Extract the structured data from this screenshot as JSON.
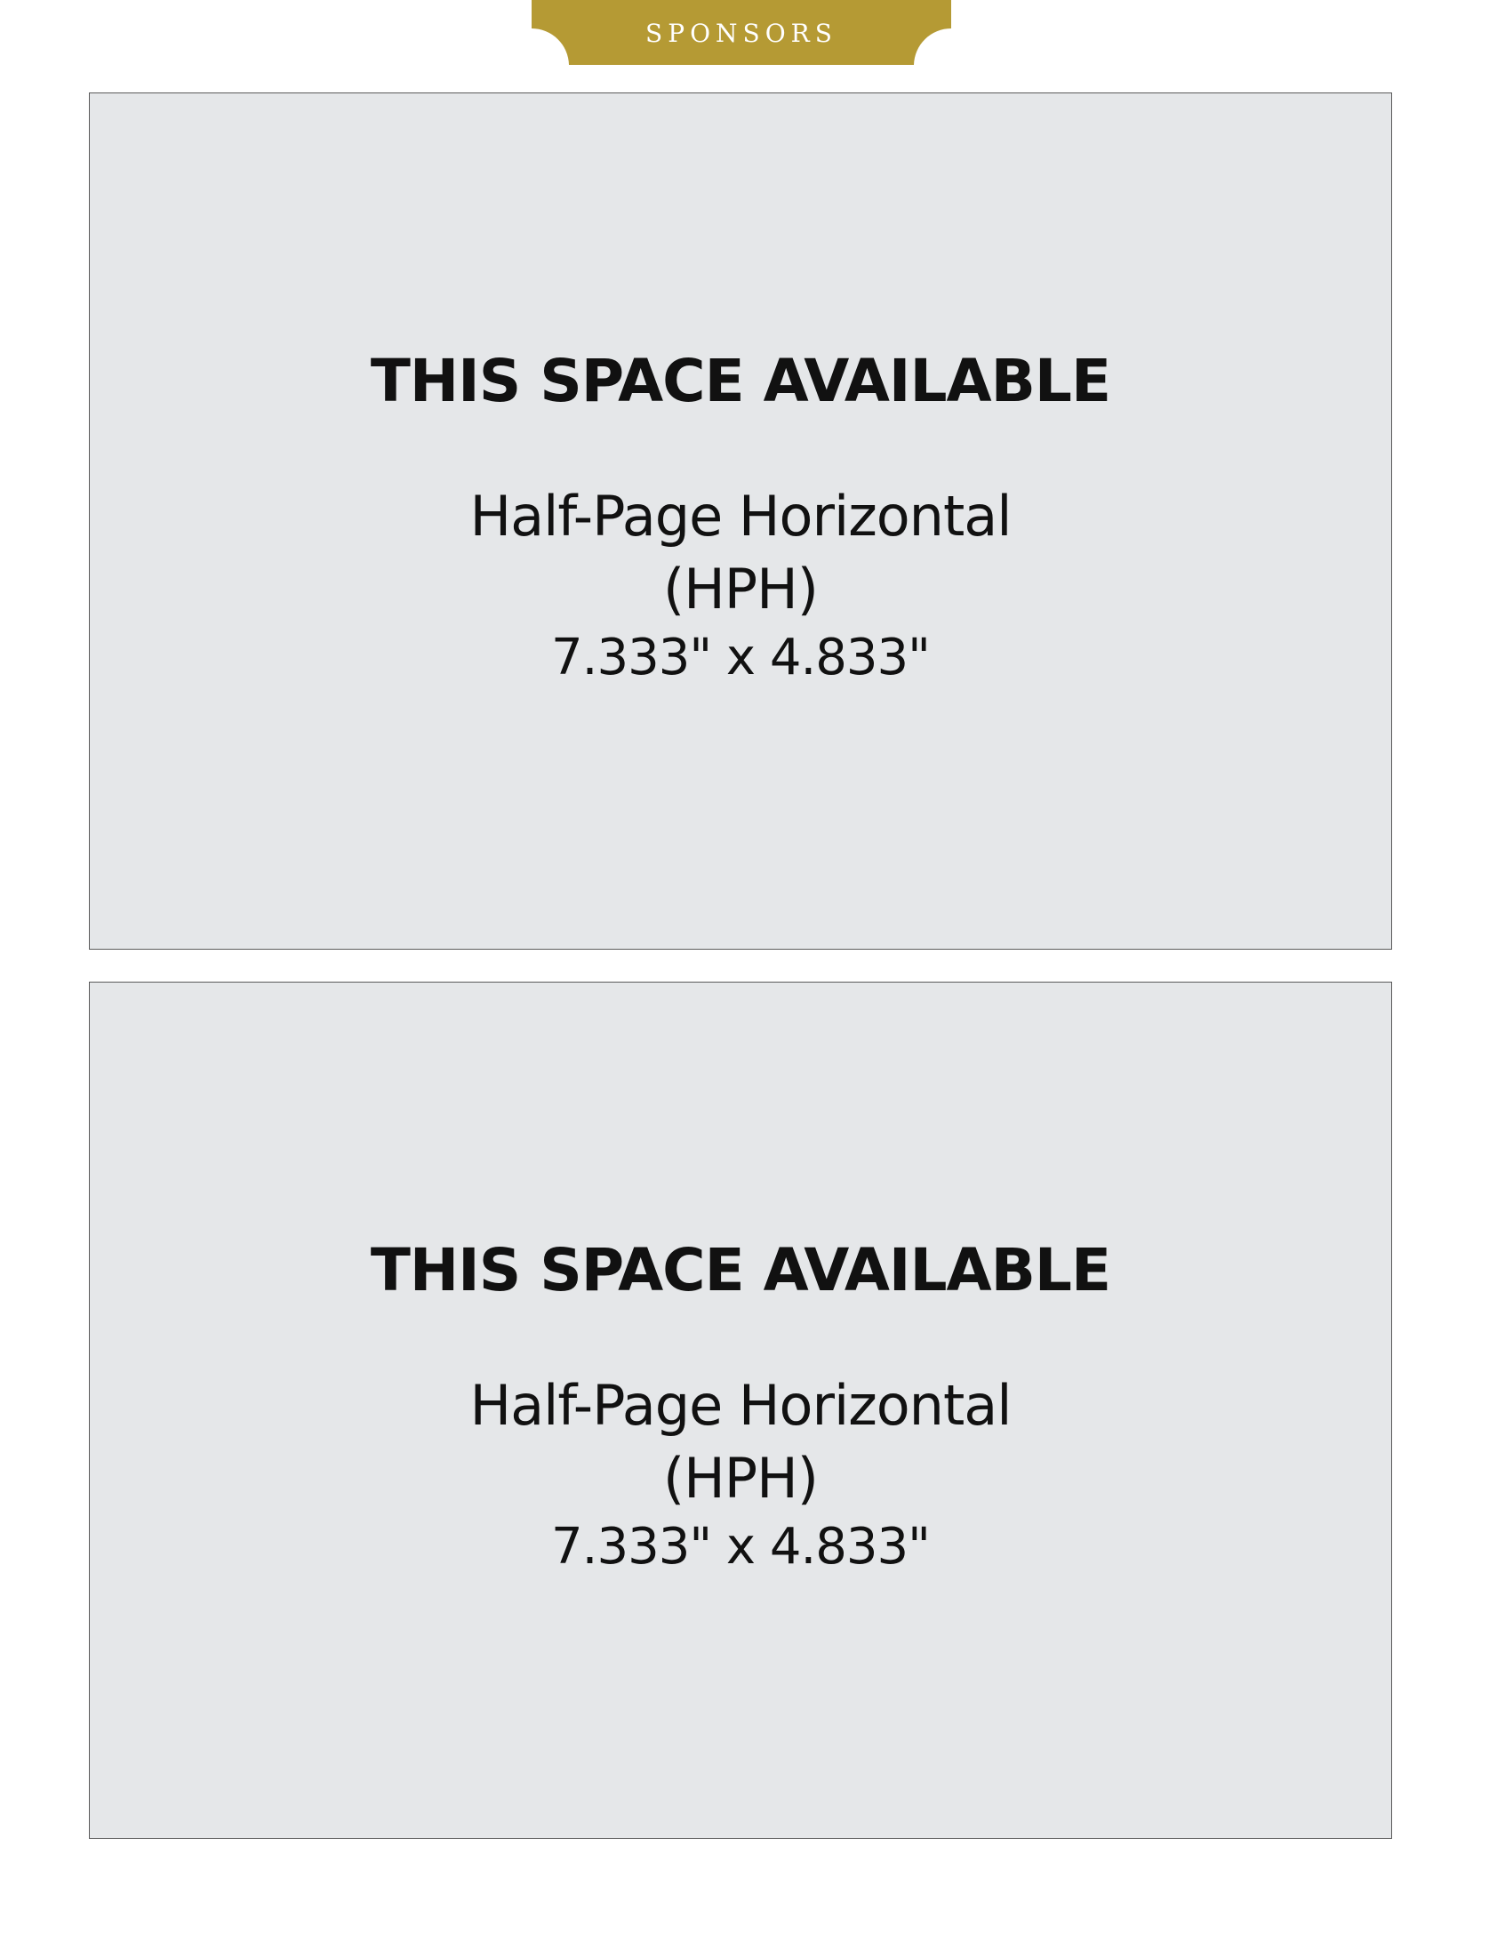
{
  "header": {
    "tab_label": "SPONSORS",
    "tab_color": "#b59a34"
  },
  "ads": [
    {
      "headline": "THIS SPACE AVAILABLE",
      "format": "Half-Page Horizontal",
      "code": "(HPH)",
      "size": "7.333\" x 4.833\""
    },
    {
      "headline": "THIS SPACE AVAILABLE",
      "format": "Half-Page Horizontal",
      "code": "(HPH)",
      "size": "7.333\" x 4.833\""
    }
  ],
  "colors": {
    "box_fill": "#e5e7e9",
    "box_border": "#5a5a5a",
    "text": "#111111"
  }
}
